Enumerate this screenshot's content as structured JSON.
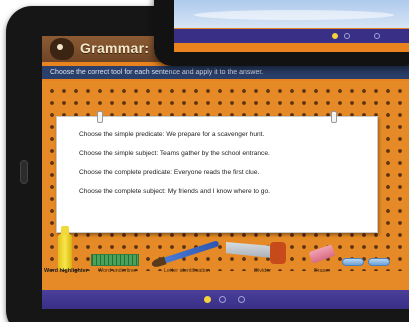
{
  "app": {
    "title": "Grammar: Sub",
    "instruction": "Choose the correct tool for each sentence and apply it to the answer."
  },
  "worksheet": {
    "questions": [
      "Choose the simple predicate: We prepare for a scavenger hunt.",
      "Choose the simple subject: Teams gather by the school entrance.",
      "Choose the complete predicate: Everyone reads the first clue.",
      "Choose the complete subject: My friends and I know where to go."
    ]
  },
  "tools": {
    "labels": [
      "Word highlighter",
      "Word underliner",
      "Letter identification",
      "Divider",
      "Eraser"
    ]
  },
  "pager": {
    "total": 3,
    "active": 0
  },
  "top_pager": {
    "total": 3,
    "active": 0
  },
  "colors": {
    "board": "#e58a26",
    "nav": "#3a2f86",
    "active_dot": "#f4d23a"
  },
  "icons": {
    "mascot": "mascot-icon",
    "highlighter": "highlighter-icon",
    "ruler": "ruler-icon",
    "brush": "brush-icon",
    "saw": "saw-icon",
    "eraser": "eraser-icon"
  }
}
